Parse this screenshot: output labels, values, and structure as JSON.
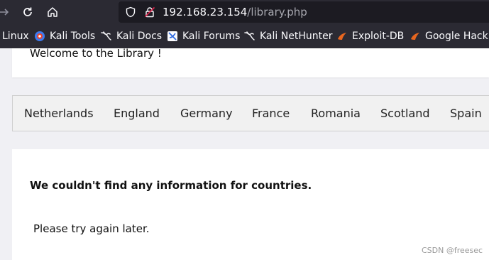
{
  "browser": {
    "url_host": "192.168.23.154",
    "url_path": "/library.php"
  },
  "bookmarks": [
    {
      "label": "Linux",
      "icon": "none"
    },
    {
      "label": "Kali Tools",
      "icon": "kali-tools-icon"
    },
    {
      "label": "Kali Docs",
      "icon": "kali-dragon-icon"
    },
    {
      "label": "Kali Forums",
      "icon": "kali-forums-icon"
    },
    {
      "label": "Kali NetHunter",
      "icon": "kali-dragon-icon"
    },
    {
      "label": "Exploit-DB",
      "icon": "exploit-db-icon"
    },
    {
      "label": "Google Hackin",
      "icon": "exploit-db-icon"
    }
  ],
  "page": {
    "welcome": "Welcome to the Library !",
    "countries": [
      "Netherlands",
      "England",
      "Germany",
      "France",
      "Romania",
      "Scotland",
      "Spain"
    ],
    "message_title": "We couldn't find any information for countries.",
    "message_body": "Please try again later."
  },
  "watermark": "CSDN @freesec",
  "colors": {
    "chrome_bg": "#2b2a33",
    "urlbar_bg": "#1c1b22",
    "page_bg": "#f0f0f4",
    "exploit_db_orange": "#e8661f"
  }
}
